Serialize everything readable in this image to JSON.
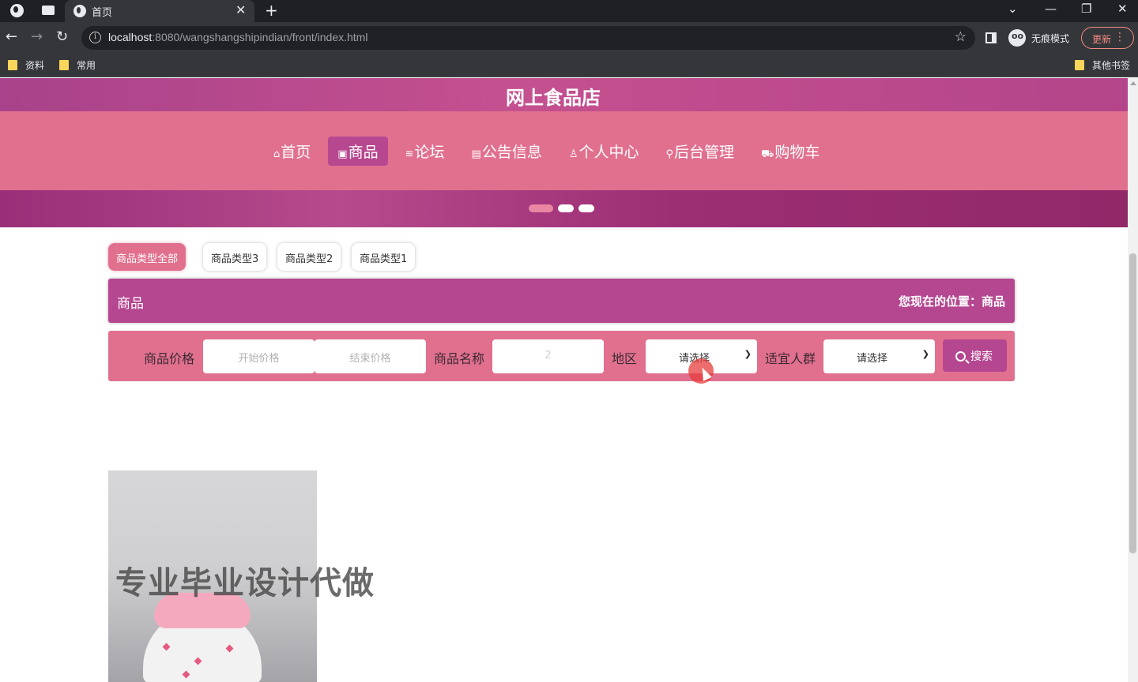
{
  "browser": {
    "tab_title": "首页",
    "url_host": "localhost",
    "url_rest": ":8080/wangshangshipindian/front/index.html",
    "incognito_label": "无痕模式",
    "update_label": "更新",
    "bookmarks": [
      "资料",
      "常用"
    ],
    "other_bookmarks": "其他书签"
  },
  "site": {
    "title": "网上食品店",
    "nav": [
      {
        "icon": "⌂",
        "label": "首页"
      },
      {
        "icon": "▣",
        "label": "商品"
      },
      {
        "icon": "≋",
        "label": "论坛"
      },
      {
        "icon": "▤",
        "label": "公告信息"
      },
      {
        "icon": "♙",
        "label": "个人中心"
      },
      {
        "icon": "⚲",
        "label": "后台管理"
      },
      {
        "icon": "⛟",
        "label": "购物车"
      }
    ],
    "active_nav": 1,
    "carousel_active": 0
  },
  "categories": [
    "商品类型全部",
    "商品类型3",
    "商品类型2",
    "商品类型1"
  ],
  "section": {
    "title": "商品",
    "location": "您现在的位置：商品"
  },
  "search": {
    "price_label": "商品价格",
    "price_min_placeholder": "开始价格",
    "price_max_placeholder": "结束价格",
    "name_label": "商品名称",
    "name_value": "2",
    "region_label": "地区",
    "region_value": "请选择",
    "audience_label": "适宜人群",
    "audience_value": "请选择",
    "button_label": "搜索"
  },
  "watermark": "专业毕业设计代做",
  "colors": {
    "header_purple": "#b54690",
    "nav_pink": "#e1708f",
    "active_nav": "#b74890"
  }
}
